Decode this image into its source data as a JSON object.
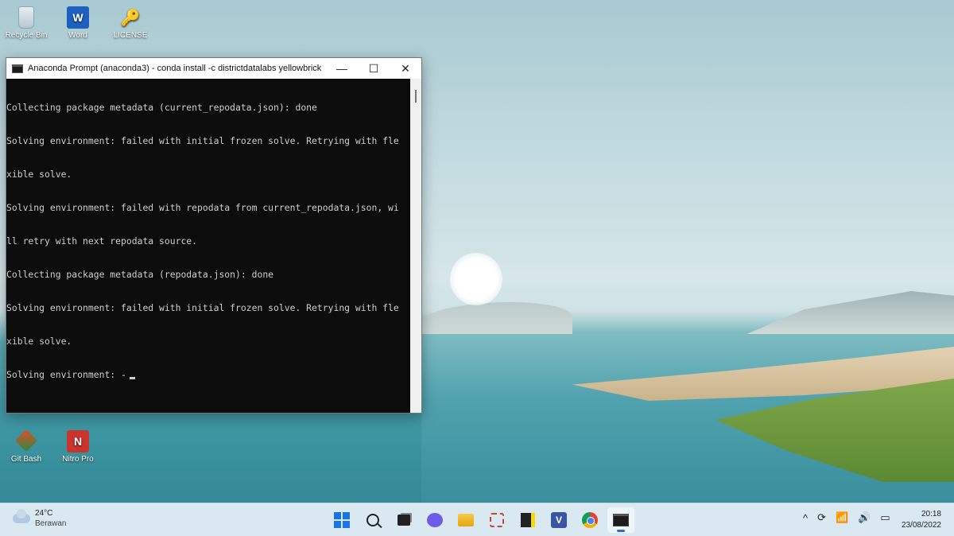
{
  "desktop": {
    "icons_top": [
      {
        "label": "Recycle Bin",
        "icon": "recycle-bin-icon"
      },
      {
        "label": "Word",
        "icon": "word-icon"
      },
      {
        "label": "LICENSE",
        "icon": "license-file-icon"
      }
    ],
    "icons_bottom": [
      {
        "label": "Git Bash",
        "icon": "git-bash-icon"
      },
      {
        "label": "Nitro Pro",
        "icon": "nitro-pro-icon"
      }
    ]
  },
  "window": {
    "title": "Anaconda Prompt (anaconda3) - conda  install -c districtdatalabs yellowbrick",
    "minimize": "—",
    "maximize": "☐",
    "close": "✕",
    "lines": [
      "Collecting package metadata (current_repodata.json): done",
      "Solving environment: failed with initial frozen solve. Retrying with fle",
      "xible solve.",
      "Solving environment: failed with repodata from current_repodata.json, wi",
      "ll retry with next repodata source.",
      "Collecting package metadata (repodata.json): done",
      "Solving environment: failed with initial frozen solve. Retrying with fle",
      "xible solve.",
      "Solving environment: -"
    ]
  },
  "taskbar": {
    "weather": {
      "temp": "24°C",
      "condition": "Berawan"
    },
    "apps": [
      "start-icon",
      "search-icon",
      "task-view-icon",
      "chat-icon",
      "file-explorer-icon",
      "snipping-tool-icon",
      "sticky-notes-icon",
      "visio-icon",
      "chrome-icon",
      "terminal-icon"
    ],
    "visio_letter": "V",
    "tray": {
      "chevron": "^",
      "wifi": "wifi-icon",
      "volume": "volume-icon",
      "battery": "battery-icon"
    },
    "clock": {
      "time": "20:18",
      "date": "23/08/2022"
    }
  }
}
